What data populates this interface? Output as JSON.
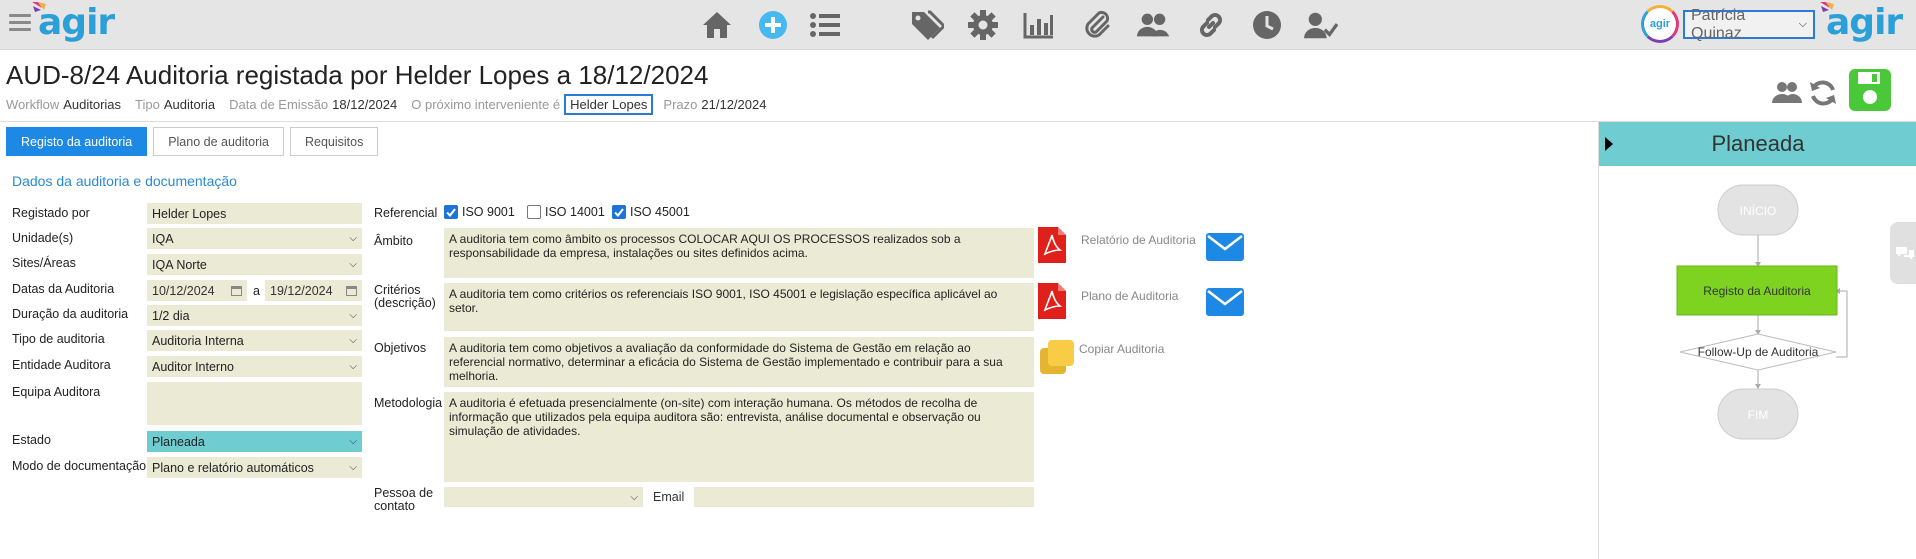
{
  "topbar": {
    "logo_text": "agir",
    "user_avatar_text": "agir",
    "user_name": "Patrícia Quinaz",
    "nav_icons": [
      "home-icon",
      "add-icon",
      "list-icon",
      "tag-icon",
      "gear-icon",
      "chart-icon",
      "attachment-icon",
      "users-icon",
      "link-icon",
      "clock-icon",
      "user-check-icon"
    ]
  },
  "header": {
    "title": "AUD-8/24 Auditoria registada por Helder Lopes a 18/12/2024",
    "meta": {
      "workflow_label": "Workflow",
      "workflow_value": "Auditorias",
      "tipo_label": "Tipo",
      "tipo_value": "Auditoria",
      "emissao_label": "Data de Emissão",
      "emissao_value": "18/12/2024",
      "interveniente_label": "O próximo interveniente é",
      "interveniente_value": "Helder Lopes",
      "prazo_label": "Prazo",
      "prazo_value": "21/12/2024"
    }
  },
  "tabs": [
    {
      "label": "Registo da auditoria",
      "active": true
    },
    {
      "label": "Plano de auditoria",
      "active": false
    },
    {
      "label": "Requisitos",
      "active": false
    }
  ],
  "section_title": "Dados da auditoria e documentação",
  "form": {
    "registado_por_label": "Registado por",
    "registado_por_value": "Helder Lopes",
    "unidade_label": "Unidade(s)",
    "unidade_value": "IQA",
    "sites_label": "Sites/Áreas",
    "sites_value": "IQA Norte",
    "datas_label": "Datas da Auditoria",
    "data_inicio": "10/12/2024",
    "data_sep": "a",
    "data_fim": "19/12/2024",
    "duracao_label": "Duração da auditoria",
    "duracao_value": "1/2 dia",
    "tipo_label": "Tipo de auditoria",
    "tipo_value": "Auditoria Interna",
    "entidade_label": "Entidade Auditora",
    "entidade_value": "Auditor Interno",
    "equipa_label": "Equipa Auditora",
    "estado_label": "Estado",
    "estado_value": "Planeada",
    "modo_label": "Modo de documentação",
    "modo_value": "Plano e relatório automáticos"
  },
  "details": {
    "referencial_label": "Referencial",
    "referenciais": [
      {
        "label": "ISO 9001",
        "checked": true
      },
      {
        "label": "ISO 14001",
        "checked": false
      },
      {
        "label": "ISO 45001",
        "checked": true
      }
    ],
    "ambito_label": "Âmbito",
    "ambito_text": "A auditoria tem como âmbito os processos COLOCAR AQUI OS PROCESSOS realizados sob a responsabilidade da empresa, instalações ou sites definidos acima.",
    "criterios_label_1": "Critérios",
    "criterios_label_2": "(descrição)",
    "criterios_text": "A auditoria tem como critérios os referenciais ISO 9001, ISO 45001 e legislação específica aplicável ao setor.",
    "objetivos_label": "Objetivos",
    "objetivos_text": "A auditoria tem como objetivos a avaliação da conformidade do Sistema de Gestão em relação ao referencial normativo, determinar a eficácia do Sistema de Gestão implementado e contribuir para a sua melhoria.",
    "metodologia_label": "Metodologia",
    "metodologia_text": "A auditoria é efetuada presencialmente (on-site) com interação humana. Os métodos de recolha de informação que  utilizados pela equipa auditora são: entrevista, análise documental e observação ou simulação de atividades.",
    "pessoa_label_1": "Pessoa de",
    "pessoa_label_2": "contato",
    "email_label": "Email",
    "relatorio_link": "Relatório de Auditoria",
    "plano_link": "Plano de Auditoria",
    "copiar_link": "Copiar Auditoria"
  },
  "workflow_panel": {
    "state": "Planeada",
    "nodes": {
      "inicio": "INÍCIO",
      "registo": "Registo da Auditoria",
      "followup": "Follow-Up de Auditoria",
      "fim": "FIM"
    },
    "colors": {
      "active": "#7ed321",
      "state": "#6fcdd1"
    }
  }
}
